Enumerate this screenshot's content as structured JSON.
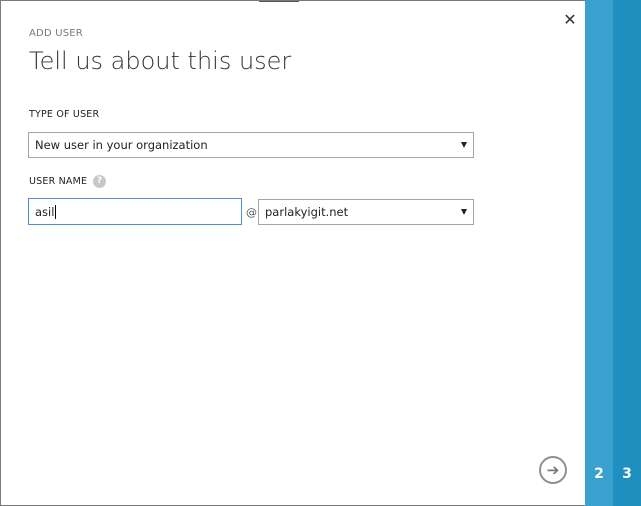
{
  "dialog": {
    "eyebrow": "ADD USER",
    "title": "Tell us about this user",
    "close_glyph": "✕"
  },
  "form": {
    "type_of_user_label": "TYPE OF USER",
    "type_of_user_value": "New user in your organization",
    "user_name_label": "USER NAME",
    "help_glyph": "?",
    "user_name_value": "asil",
    "at_symbol": "@",
    "domain_value": "parlakyigit.net"
  },
  "footer": {
    "next_glyph": "➔"
  },
  "steps": [
    {
      "number": "2"
    },
    {
      "number": "3"
    }
  ],
  "colors": {
    "step_2_bg": "#3aa1cf",
    "step_3_bg": "#1f8fc0",
    "focus_border": "#4d90d9"
  },
  "icons": {
    "close": "close-icon",
    "help": "help-icon",
    "next": "arrow-right-circle-icon",
    "dropdown": "chevron-down-icon"
  }
}
